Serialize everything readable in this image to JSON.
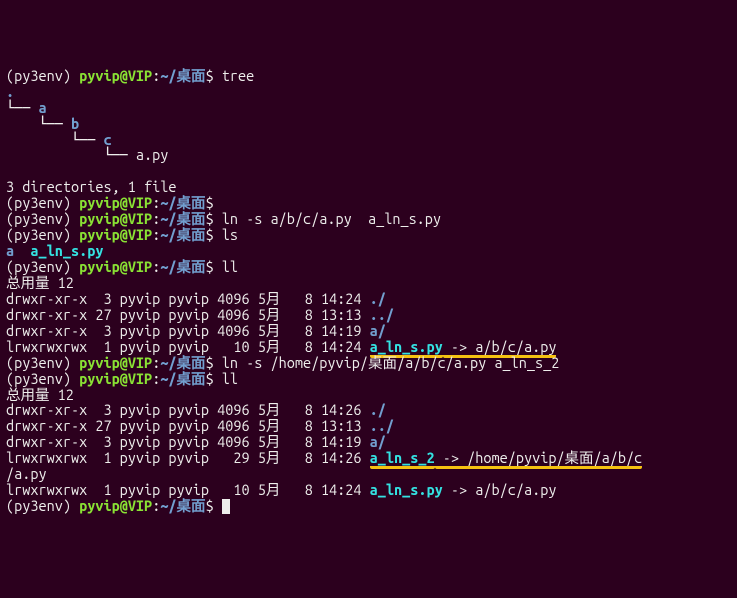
{
  "p1_env": "(py3env) ",
  "p1_user": "pyvip@VIP",
  "p1_sep": ":",
  "p1_path": "~/桌面",
  "p1_dollar": "$",
  "cmd1": " tree",
  "tree_dot": ".",
  "tree_l1": "└── ",
  "tree_a": "a",
  "tree_l2": "    └── ",
  "tree_b": "b",
  "tree_l3": "        └── ",
  "tree_c": "c",
  "tree_l4": "            └── a.py",
  "tree_sum": "3 directories, 1 file",
  "cmd2_blank": "",
  "cmd3": " ln -s a/b/c/a.py  a_ln_s.py",
  "cmd4": " ls",
  "ls_a": "a",
  "ls_sp": "  ",
  "ls_link": "a_ln_s.py",
  "cmd5": " ll",
  "total": "总用量 12",
  "r1": "drwxr-xr-x  3 pyvip pyvip 4096 5月   8 14:24 ",
  "r1n": "./",
  "r2": "drwxr-xr-x 27 pyvip pyvip 4096 5月   8 13:13 ",
  "r2n": "../",
  "r3": "drwxr-xr-x  3 pyvip pyvip 4096 5月   8 14:19 ",
  "r3n": "a/",
  "r4": "lrwxrwxrwx  1 pyvip pyvip   10 5月   8 14:24 ",
  "r4link": "a_ln_s.py",
  "r4arrow": " -> a/b/c/a.py",
  "cmd6": " ln -s /home/pyvip/桌面/a/b/c/a.py a_ln_s_2",
  "cmd7": " ll",
  "total2": "总用量 12",
  "s1": "drwxr-xr-x  3 pyvip pyvip 4096 5月   8 14:26 ",
  "s1n": "./",
  "s2": "drwxr-xr-x 27 pyvip pyvip 4096 5月   8 13:13 ",
  "s2n": "../",
  "s3": "drwxr-xr-x  3 pyvip pyvip 4096 5月   8 14:19 ",
  "s3n": "a/",
  "s4": "lrwxrwxrwx  1 pyvip pyvip   29 5月   8 14:26 ",
  "s4link": "a_ln_s_2",
  "s4arrow": " -> /home/pyvip/桌面/a/b/c",
  "s4cont": "/a.py",
  "s5": "lrwxrwxrwx  1 pyvip pyvip   10 5月   8 14:24 ",
  "s5link": "a_ln_s.py",
  "s5arrow": " -> a/b/c/a.py",
  "final_sp": " "
}
